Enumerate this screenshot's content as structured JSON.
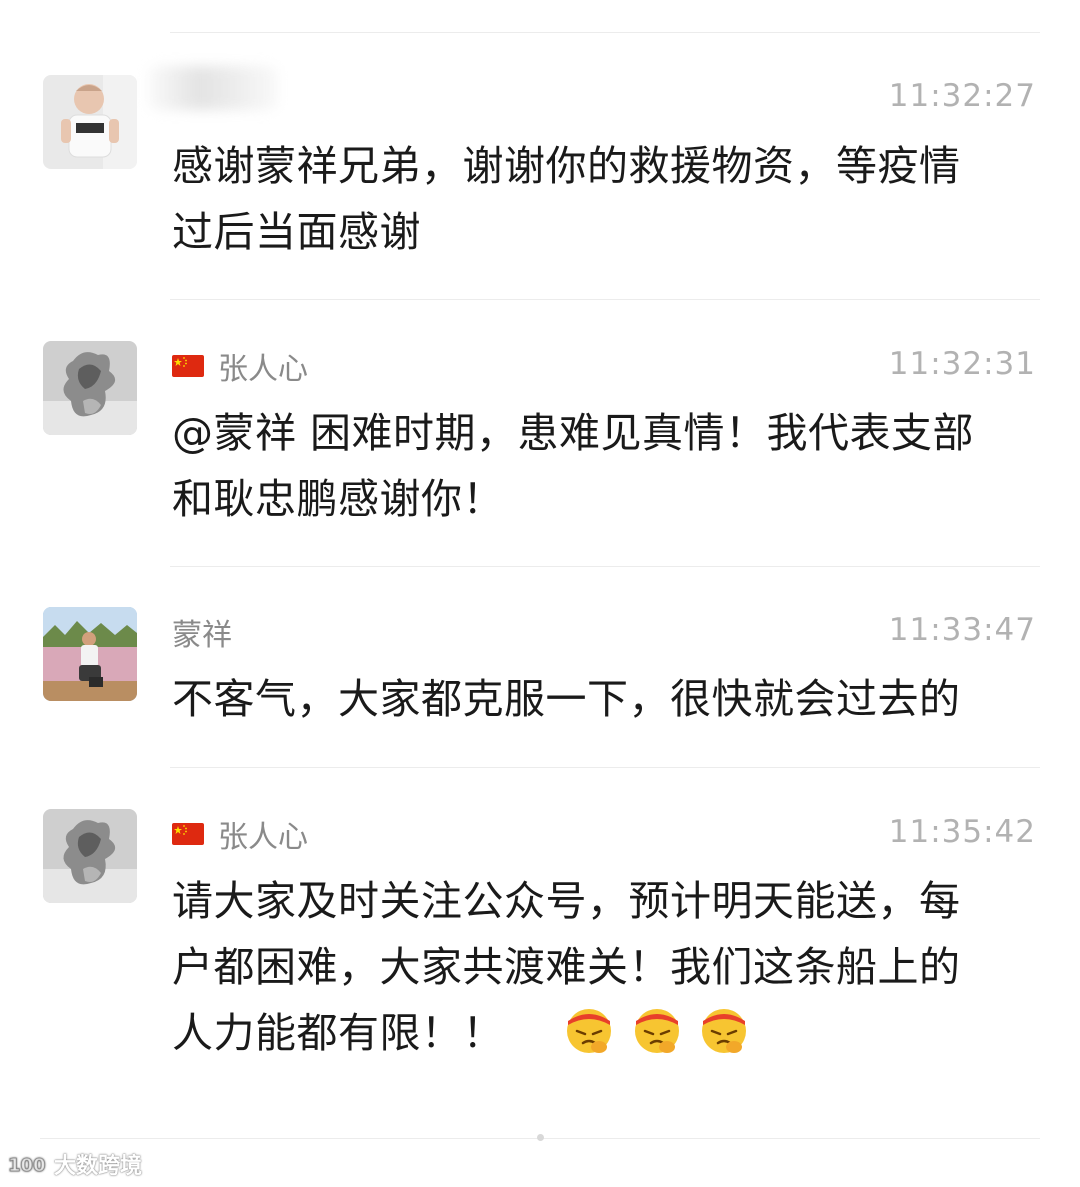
{
  "messages": [
    {
      "name": "",
      "time": "11:32:27",
      "text_lines": [
        "感谢蒙祥兄弟，谢谢你的救援物资，等疫情",
        "过后当面感谢"
      ],
      "has_flag": false
    },
    {
      "name": "张人心",
      "time": "11:32:31",
      "text_lines": [
        "@蒙祥 困难时期，患难见真情！我代表支部",
        "和耿忠鹏感谢你！"
      ],
      "has_flag": true
    },
    {
      "name": "蒙祥",
      "time": "11:33:47",
      "text_lines": [
        "不客气，大家都克服一下，很快就会过去的"
      ],
      "has_flag": false
    },
    {
      "name": "张人心",
      "time": "11:35:42",
      "text_lines": [
        "请大家及时关注公众号，预计明天能送，每",
        "户都困难，大家共渡难关！我们这条船上的",
        "人力能都有限！！"
      ],
      "has_flag": true
    }
  ],
  "emoji_names": [
    "facepalm-headband-emoji",
    "facepalm-headband-emoji",
    "facepalm-headband-emoji"
  ],
  "watermark": "大数跨境",
  "colors": {
    "name": "#8a8a8a",
    "time": "#b2b2b2",
    "text": "#1a1a1a",
    "separator": "#ececec"
  }
}
